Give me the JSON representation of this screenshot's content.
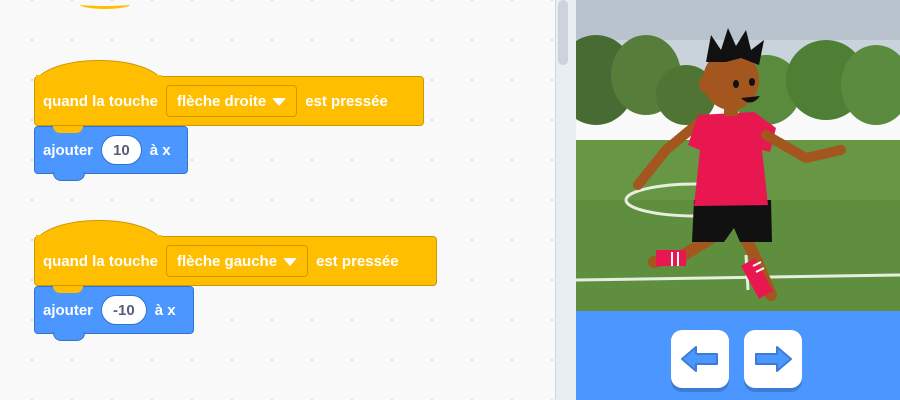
{
  "scripts": [
    {
      "hat": {
        "prefix": "quand la touche",
        "key": "flèche droite",
        "suffix": "est pressée"
      },
      "motion": {
        "label": "ajouter",
        "value": "10",
        "suffix": "à x"
      }
    },
    {
      "hat": {
        "prefix": "quand la touche",
        "key": "flèche gauche",
        "suffix": "est pressée"
      },
      "motion": {
        "label": "ajouter",
        "value": "-10",
        "suffix": "à x"
      }
    }
  ],
  "controls": {
    "left_icon": "left-arrow-icon",
    "right_icon": "right-arrow-icon"
  },
  "colors": {
    "events_block": "#ffbf00",
    "motion_block": "#4c97ff",
    "jersey": "#e8174f",
    "controls_bar": "#4c97ff"
  }
}
